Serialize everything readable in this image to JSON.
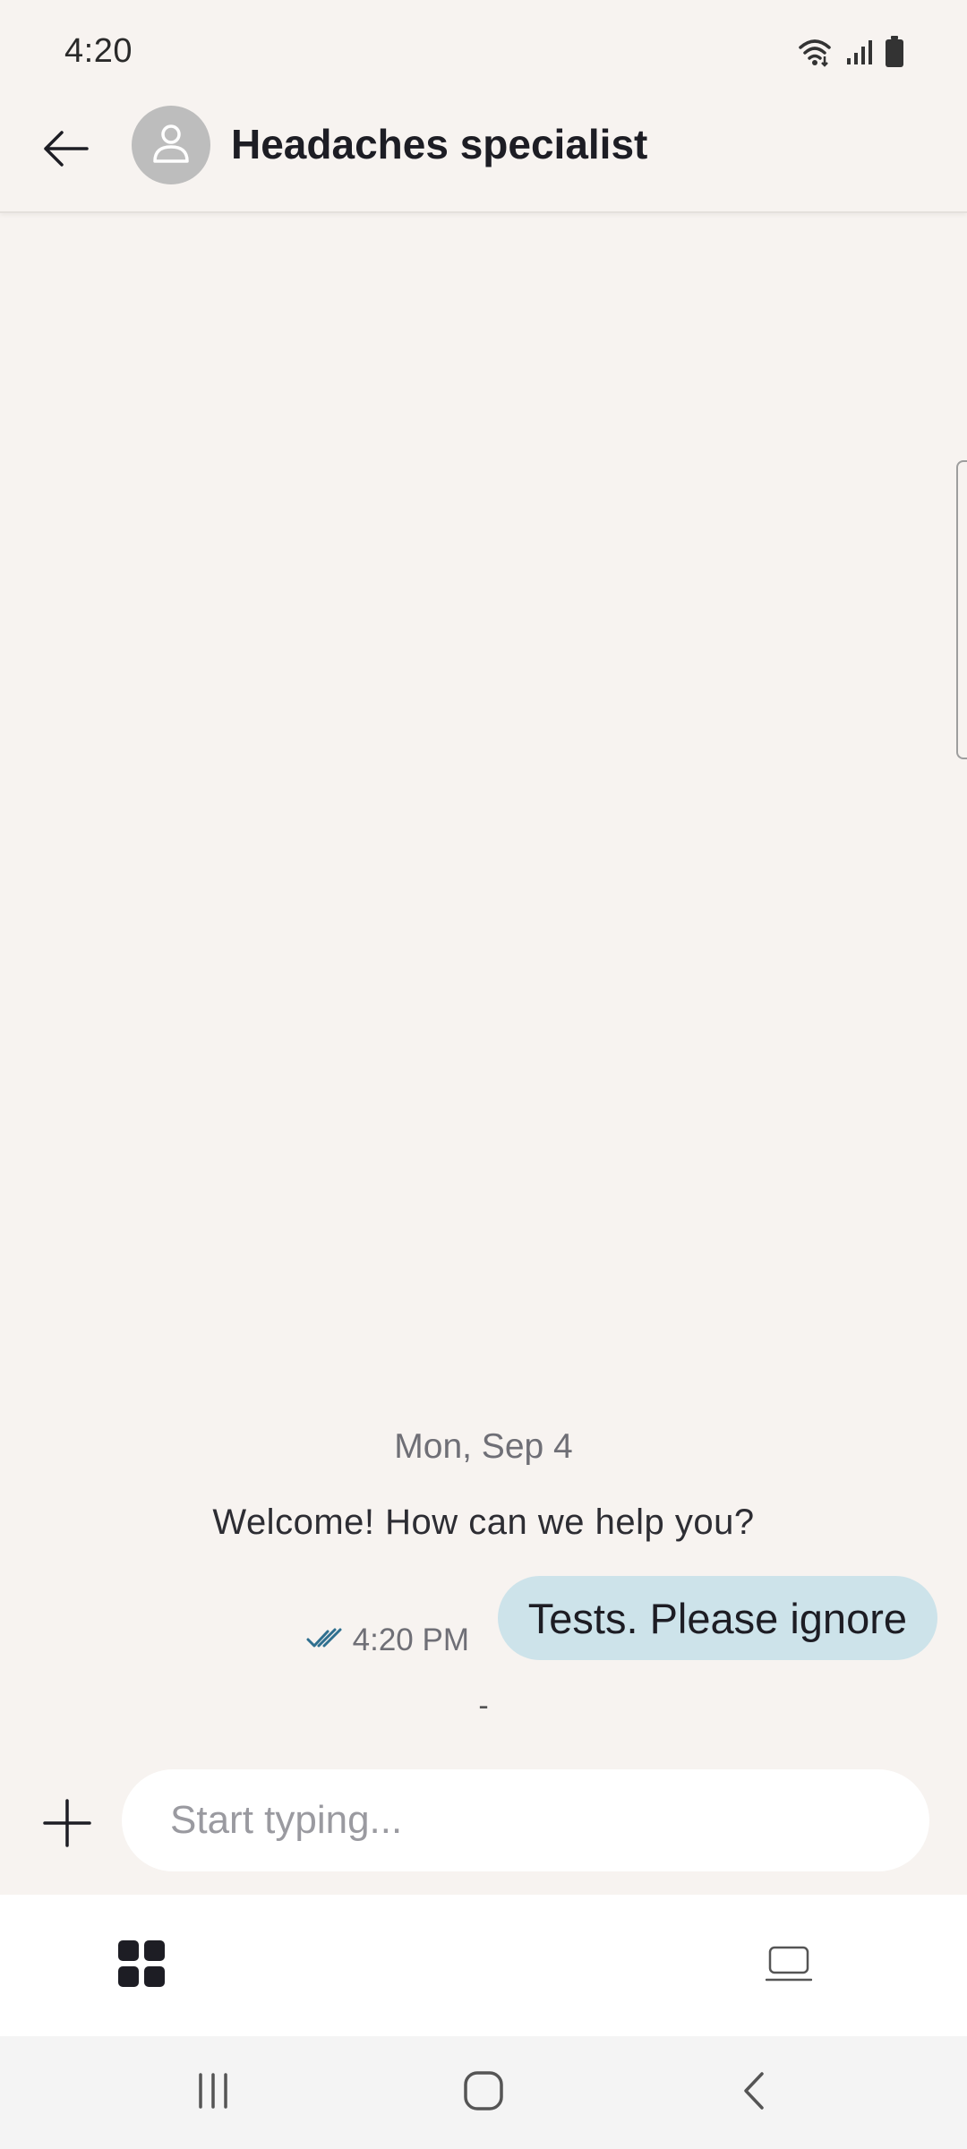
{
  "status_bar": {
    "time": "4:20",
    "icons": [
      "wifi-icon",
      "signal-icon",
      "battery-icon"
    ]
  },
  "header": {
    "title": "Headaches specialist",
    "back_icon": "arrow-left-icon",
    "avatar_icon": "person-icon"
  },
  "chat": {
    "date_label": "Mon, Sep 4",
    "welcome_message": "Welcome! How can we help you?",
    "messages": [
      {
        "text": "Tests. Please ignore",
        "time": "4:20 PM",
        "status_icon": "double-check-icon"
      }
    ],
    "typing_indicator": "-"
  },
  "composer": {
    "attach_icon": "plus-icon",
    "input_value": "",
    "input_placeholder": "Start typing..."
  },
  "tab_bar": {
    "tabs": [
      {
        "icon": "grid-icon",
        "active": true
      },
      {
        "icon": "laptop-icon",
        "active": false
      }
    ]
  },
  "nav_bar": {
    "buttons": [
      "recent-apps-icon",
      "home-icon",
      "back-icon"
    ]
  },
  "colors": {
    "background": "#f7f3f0",
    "bubble": "#cde3ea",
    "read_check": "#2f6f8f",
    "text_primary": "#1d1d24",
    "text_secondary": "#6f6f76"
  }
}
